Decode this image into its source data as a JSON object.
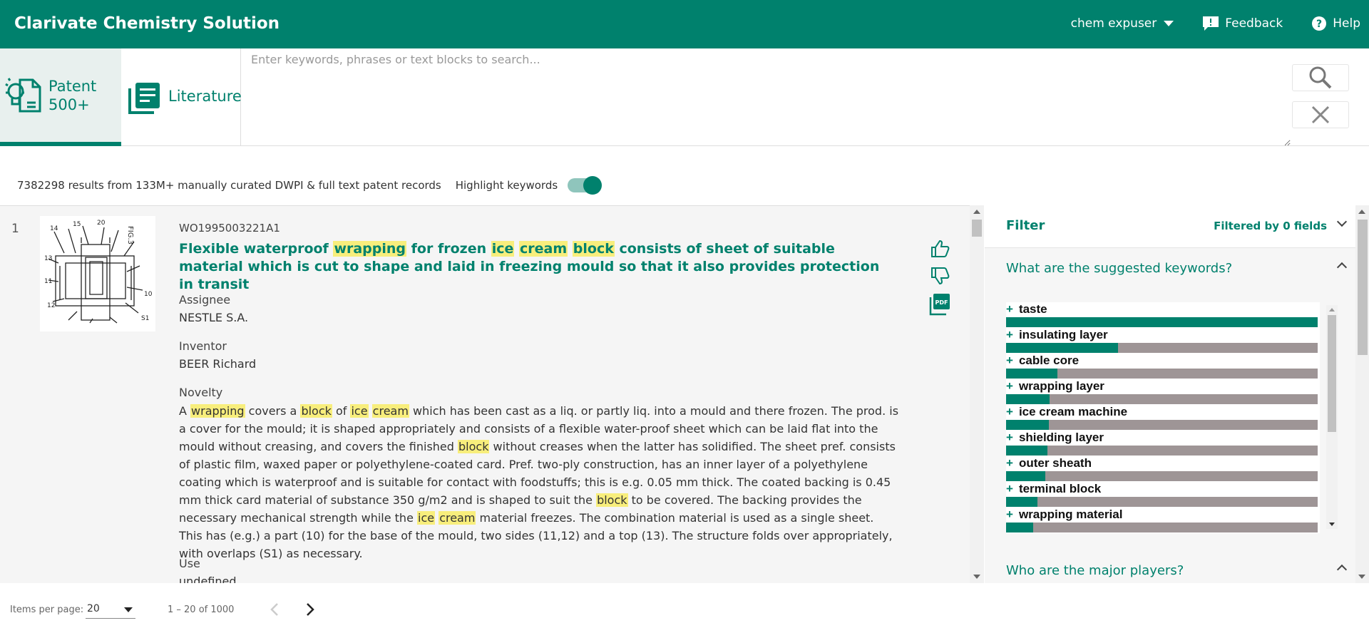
{
  "header": {
    "title": "Clarivate Chemistry Solution",
    "user": "chem expuser",
    "feedback": "Feedback",
    "help": "Help"
  },
  "tabs": {
    "patent_label": "Patent",
    "patent_count": "500+",
    "literature_label": "Literature"
  },
  "search": {
    "placeholder": "Enter keywords, phrases or text blocks to search..."
  },
  "results_info": {
    "summary": "7382298 results from 133M+ manually curated DWPI & full text patent records",
    "highlight_label": "Highlight keywords",
    "highlight_on": true
  },
  "result": {
    "index": "1",
    "pub_number": "WO1995003221A1",
    "title": {
      "t1": "Flexible waterproof ",
      "h1": "wrapping",
      "t2": " for frozen ",
      "h2": "ice",
      "t3": " ",
      "h3": "cream",
      "t4": " ",
      "h4": "block",
      "t5": " consists of sheet of suitable material which is cut to shape and laid in freezing mould so that it also provides protection in transit"
    },
    "assignee_label": "Assignee",
    "assignee": "NESTLE S.A.",
    "inventor_label": "Inventor",
    "inventor": "BEER Richard",
    "novelty_label": "Novelty",
    "novelty": {
      "t1": "A ",
      "h1": "wrapping",
      "t2": " covers a ",
      "h2": "block",
      "t3": " of ",
      "h3": "ice",
      "t4": " ",
      "h4": "cream",
      "t5": " which has been cast as a liq. or partly liq. into a mould and there frozen. The prod. is a cover for the mould; it is shaped appropriately and consists of a flexible water-proof sheet which can be laid flat into the mould without creasing, and covers the finished ",
      "h5": "block",
      "t6": " without creases when the latter has solidified. The sheet pref. consists of plastic film, waxed paper or polyethylene-coated card. Pref. two-ply construction, has an inner layer of a polyethylene coating which is waterproof and is suitable for contact with foodstuffs; this is e.g. 0.05 mm thick. The coated backing is 0.45 mm thick card material of substance 350 g/m2 and is shaped to suit the ",
      "h6": "block",
      "t7": " to be covered. The backing provides the necessary mechanical strength while the ",
      "h7": "ice",
      "t8": " ",
      "h8": "cream",
      "t9": " material freezes. The combination material is used as a single sheet. This has (e.g.) a part (10) for the base of the mould, two sides (11,12) and a top (13). The structure folds over appropriately, with overlaps (S1) as necessary."
    },
    "use_label": "Use",
    "use_value": "undefined",
    "pdf_label": "PDF"
  },
  "filter": {
    "title": "Filter",
    "filtered_by": "Filtered by 0 fields",
    "q1": "What are the suggested keywords?",
    "q2": "Who are the major players?",
    "keywords": [
      {
        "name": "taste",
        "share": 1.0
      },
      {
        "name": "insulating layer",
        "share": 0.36
      },
      {
        "name": "cable core",
        "share": 0.165
      },
      {
        "name": "wrapping layer",
        "share": 0.14
      },
      {
        "name": "ice cream machine",
        "share": 0.138
      },
      {
        "name": "shielding layer",
        "share": 0.133
      },
      {
        "name": "outer sheath",
        "share": 0.125
      },
      {
        "name": "terminal block",
        "share": 0.1
      },
      {
        "name": "wrapping material",
        "share": 0.088
      }
    ]
  },
  "paginator": {
    "items_per_page_label": "Items per page:",
    "items_per_page": "20",
    "range": "1 – 20 of 1000"
  },
  "colors": {
    "brand": "#00816d",
    "highlight": "#f8ee7c",
    "bar_rest": "#9e9596"
  }
}
